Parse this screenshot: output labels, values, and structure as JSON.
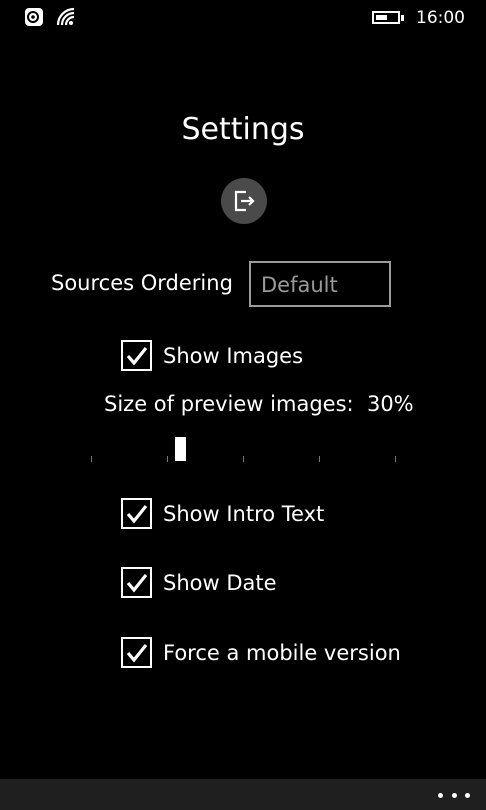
{
  "status_bar": {
    "time": "16:00",
    "battery_level": 0.55
  },
  "settings": {
    "title": "Settings",
    "sources_ordering": {
      "label": "Sources Ordering",
      "value": "Default"
    },
    "show_images": {
      "label": "Show Images",
      "checked": true
    },
    "preview_size": {
      "label": "Size of preview images:",
      "value_text": "30%",
      "value": 0.3
    },
    "show_intro_text": {
      "label": "Show Intro Text",
      "checked": true
    },
    "show_date": {
      "label": "Show Date",
      "checked": true
    },
    "force_mobile": {
      "label": "Force a mobile version",
      "checked": true
    }
  },
  "icons": {
    "logout": "logout-icon",
    "more": "more-dots-icon"
  },
  "colors": {
    "background": "#000000",
    "button_fill": "#4a4a4a",
    "field_border": "#9a9a9a",
    "app_bar": "#1f1f1f"
  }
}
